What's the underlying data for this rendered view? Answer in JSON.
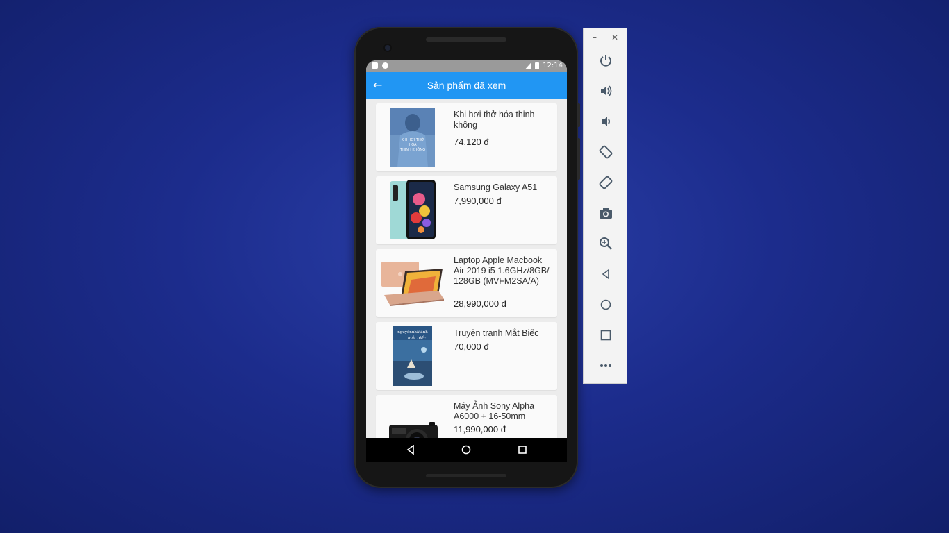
{
  "emulator": {
    "status_time": "12:14",
    "app_title": "Sản phẩm đã xem",
    "products": [
      {
        "name": "Khi hơi thở hóa thinh không",
        "price": "74,120 đ",
        "image": "book-cover-khi-hoi-tho-hoa-thinh-khong",
        "cover_text": "KHI HƠI THỞ HÓA THINH KHÔNG"
      },
      {
        "name": "Samsung Galaxy A51",
        "price": "7,990,000 đ",
        "image": "smartphone"
      },
      {
        "name": "Laptop Apple Macbook Air 2019 i5 1.6GHz/8GB/ 128GB (MVFM2SA/A)",
        "price": "28,990,000 đ",
        "image": "laptop"
      },
      {
        "name": "Truyện tranh Mắt Biếc",
        "price": "70,000 đ",
        "image": "book-cover-mat-biec",
        "cover_text_author": "nguyễnnhậtánh",
        "cover_text_title": "mắt biếc"
      },
      {
        "name": "Máy Ảnh Sony Alpha A6000 + 16-50mm",
        "price": "11,990,000 đ",
        "image": "camera"
      }
    ]
  },
  "toolbar": {
    "window_controls": [
      "minimize-icon",
      "close-icon"
    ],
    "items": [
      "power-icon",
      "volume-up-icon",
      "volume-down-icon",
      "rotate-left-icon",
      "rotate-right-icon",
      "camera-icon",
      "zoom-icon",
      "back-icon",
      "home-icon",
      "overview-icon",
      "more-icon"
    ]
  },
  "colors": {
    "app_bar": "#2196f3",
    "desktop_background": "#1c2c8c"
  }
}
